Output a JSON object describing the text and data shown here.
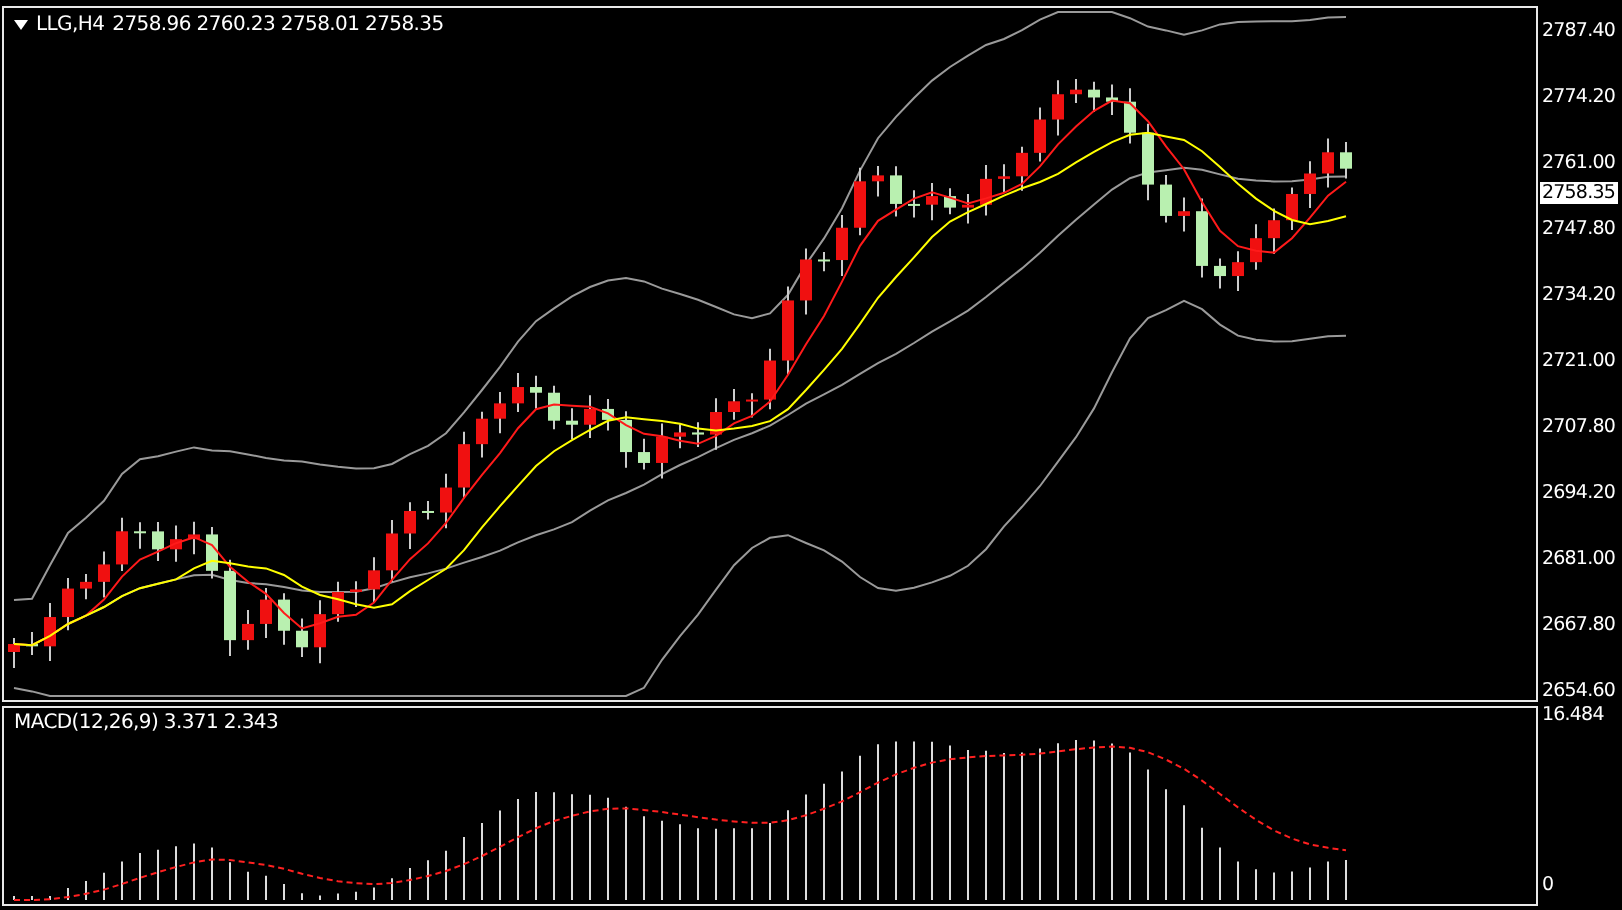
{
  "chart": {
    "symbol_label": "LLG,H4",
    "ohlc": "2758.96 2760.23 2758.01 2758.35",
    "price_axis": [
      "2787.40",
      "2774.20",
      "2761.00",
      "2747.80",
      "2734.20",
      "2721.00",
      "2707.80",
      "2694.20",
      "2681.00",
      "2667.80",
      "2654.60"
    ],
    "current_price": "2758.35"
  },
  "macd": {
    "label": "MACD(12,26,9) 3.371 2.343",
    "axis": [
      "16.484",
      "0"
    ]
  }
}
